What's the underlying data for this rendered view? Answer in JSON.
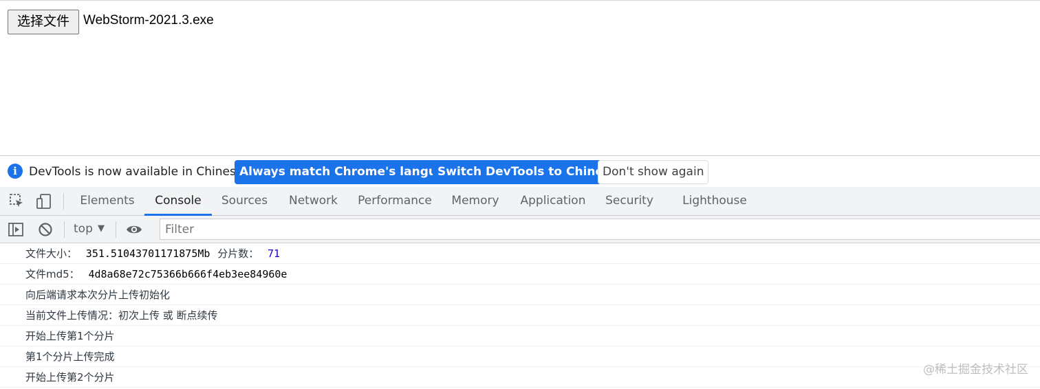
{
  "page": {
    "file_button_label": "选择文件",
    "file_name": "WebStorm-2021.3.exe"
  },
  "infobar": {
    "icon": "info-icon",
    "message": "DevTools is now available in Chinese!",
    "btn_match": "Always match Chrome's language",
    "btn_switch": "Switch DevTools to Chinese",
    "btn_dismiss": "Don't show again"
  },
  "tabs": [
    "Elements",
    "Console",
    "Sources",
    "Network",
    "Performance",
    "Memory",
    "Application",
    "Security",
    "Lighthouse"
  ],
  "active_tab": "Console",
  "toolbar": {
    "context": "top",
    "filter_placeholder": "Filter"
  },
  "logs": {
    "size_label": "文件大小：",
    "size_value": "351.51043701171875Mb",
    "chunks_label": "分片数：",
    "chunks_value": "71",
    "md5_label": "文件md5：",
    "md5_value": "4d8a68e72c75366b666f4eb3ee84960e",
    "line3": "向后端请求本次分片上传初始化",
    "line4": "当前文件上传情况：初次上传 或 断点续传",
    "line5": "开始上传第1个分片",
    "line6": "第1个分片上传完成",
    "line7": "开始上传第2个分片"
  },
  "watermark": "@稀土掘金技术社区",
  "colors": {
    "accent": "#1a73e8",
    "number": "#1c00cf"
  }
}
